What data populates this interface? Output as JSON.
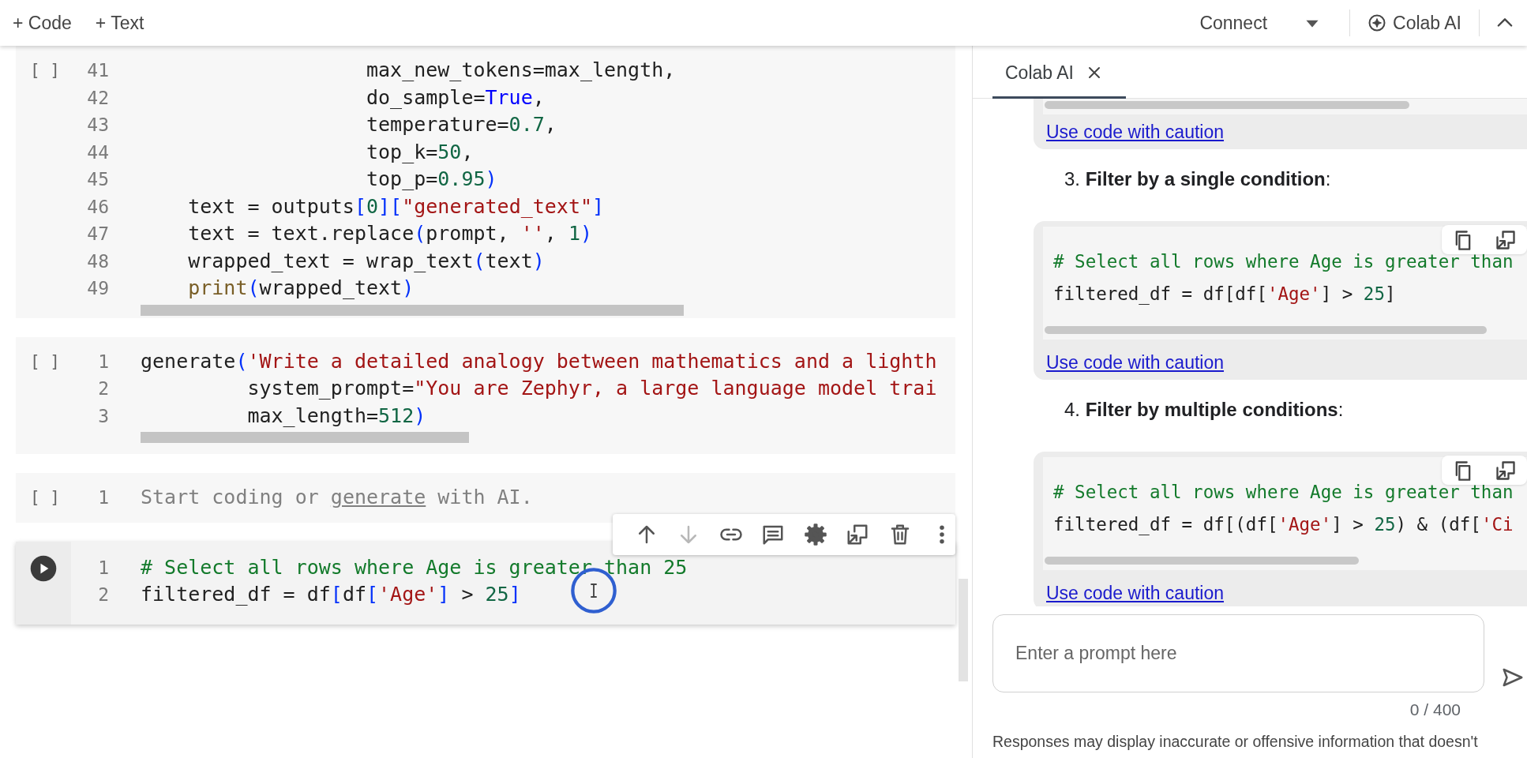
{
  "top_bar": {
    "insert_buttons": [
      "+ Code",
      "+ Text"
    ],
    "connect_button": "Connect",
    "ai_button": "Colab AI"
  },
  "cells": [
    {
      "focused": false,
      "exec_label": "[ ]",
      "scrollable": true,
      "lines": [
        {
          "number": "41",
          "tokens": [
            {
              "text": "                   max_new_tokens=max_length,",
              "kind": "plain"
            }
          ]
        },
        {
          "number": "42",
          "tokens": [
            {
              "text": "                   do_sample=",
              "kind": "plain"
            },
            {
              "text": "True",
              "kind": "keyword"
            },
            {
              "text": ",",
              "kind": "plain"
            }
          ]
        },
        {
          "number": "43",
          "tokens": [
            {
              "text": "                   temperature=",
              "kind": "plain"
            },
            {
              "text": "0.7",
              "kind": "number"
            },
            {
              "text": ",",
              "kind": "plain"
            }
          ]
        },
        {
          "number": "44",
          "tokens": [
            {
              "text": "                   top_k=",
              "kind": "plain"
            },
            {
              "text": "50",
              "kind": "number"
            },
            {
              "text": ",",
              "kind": "plain"
            }
          ]
        },
        {
          "number": "45",
          "tokens": [
            {
              "text": "                   top_p=",
              "kind": "plain"
            },
            {
              "text": "0.95",
              "kind": "number"
            },
            {
              "text": ")",
              "kind": "bracket"
            }
          ]
        },
        {
          "number": "46",
          "tokens": [
            {
              "text": "    text = outputs",
              "kind": "plain"
            },
            {
              "text": "[",
              "kind": "bracket"
            },
            {
              "text": "0",
              "kind": "number"
            },
            {
              "text": "][",
              "kind": "bracket"
            },
            {
              "text": "\"generated_text\"",
              "kind": "string"
            },
            {
              "text": "]",
              "kind": "bracket"
            }
          ]
        },
        {
          "number": "47",
          "tokens": [
            {
              "text": "    text = text.replace",
              "kind": "plain"
            },
            {
              "text": "(",
              "kind": "bracket"
            },
            {
              "text": "prompt, ",
              "kind": "plain"
            },
            {
              "text": "''",
              "kind": "string"
            },
            {
              "text": ", ",
              "kind": "plain"
            },
            {
              "text": "1",
              "kind": "number"
            },
            {
              "text": ")",
              "kind": "bracket"
            }
          ]
        },
        {
          "number": "48",
          "tokens": [
            {
              "text": "    wrapped_text = wrap_text",
              "kind": "plain"
            },
            {
              "text": "(",
              "kind": "bracket"
            },
            {
              "text": "text",
              "kind": "plain"
            },
            {
              "text": ")",
              "kind": "bracket"
            }
          ]
        },
        {
          "number": "49",
          "tokens": [
            {
              "text": "    print",
              "kind": "function"
            },
            {
              "text": "(",
              "kind": "bracket"
            },
            {
              "text": "wrapped_text",
              "kind": "plain"
            },
            {
              "text": ")",
              "kind": "bracket"
            }
          ]
        }
      ]
    },
    {
      "focused": false,
      "exec_label": "[ ]",
      "scrollable": true,
      "lines": [
        {
          "number": "1",
          "tokens": [
            {
              "text": "generate",
              "kind": "plain"
            },
            {
              "text": "(",
              "kind": "bracket"
            },
            {
              "text": "'Write a detailed analogy between mathematics and a lighth",
              "kind": "string"
            }
          ]
        },
        {
          "number": "2",
          "tokens": [
            {
              "text": "         system_prompt=",
              "kind": "plain"
            },
            {
              "text": "\"You are Zephyr, a large language model trai",
              "kind": "string"
            }
          ]
        },
        {
          "number": "3",
          "tokens": [
            {
              "text": "         max_length=",
              "kind": "plain"
            },
            {
              "text": "512",
              "kind": "number"
            },
            {
              "text": ")",
              "kind": "bracket"
            }
          ]
        }
      ]
    },
    {
      "focused": false,
      "exec_label": "[ ]",
      "scrollable": false,
      "lines": [
        {
          "number": "1",
          "tokens": [
            {
              "text": "Start coding or ",
              "kind": "hint"
            },
            {
              "text": "generate",
              "kind": "hint-link"
            },
            {
              "text": " with AI.",
              "kind": "hint"
            }
          ]
        }
      ]
    },
    {
      "focused": true,
      "scrollable": false,
      "lines": [
        {
          "number": "1",
          "tokens": [
            {
              "text": "# Select all rows where Age is greater than 25",
              "kind": "comment"
            }
          ]
        },
        {
          "number": "2",
          "tokens": [
            {
              "text": "filtered_df = df",
              "kind": "plain"
            },
            {
              "text": "[",
              "kind": "bracket"
            },
            {
              "text": "df",
              "kind": "plain"
            },
            {
              "text": "[",
              "kind": "bracket"
            },
            {
              "text": "'Age'",
              "kind": "string"
            },
            {
              "text": "]",
              "kind": "bracket"
            },
            {
              "text": " > ",
              "kind": "plain"
            },
            {
              "text": "25",
              "kind": "number"
            },
            {
              "text": "]",
              "kind": "bracket"
            }
          ]
        }
      ]
    }
  ],
  "cell_toolbar": [
    {
      "disabled": false
    },
    {
      "disabled": true
    },
    {
      "disabled": false
    },
    {
      "disabled": false
    },
    {
      "disabled": false
    },
    {
      "disabled": false
    },
    {
      "disabled": false
    },
    {
      "disabled": false
    }
  ],
  "ai_panel": {
    "tab": {
      "label": "Colab AI",
      "selected": true
    },
    "messages": [
      {
        "kind": "code",
        "link": "Use code with caution"
      },
      {
        "kind": "heading",
        "text": "3. **Filter by a single condition**:"
      },
      {
        "kind": "code",
        "lines": [
          {
            "tokens": [
              {
                "text": "# Select all rows where Age is greater than",
                "kind": "comment"
              }
            ]
          },
          {
            "tokens": [
              {
                "text": "filtered_df = df[df[",
                "kind": "plain"
              },
              {
                "text": "'Age'",
                "kind": "string"
              },
              {
                "text": "] > ",
                "kind": "plain"
              },
              {
                "text": "25",
                "kind": "number"
              },
              {
                "text": "]",
                "kind": "plain"
              }
            ]
          }
        ],
        "link": "Use code with caution"
      },
      {
        "kind": "heading",
        "text": "4. **Filter by multiple conditions**:"
      },
      {
        "kind": "code",
        "lines": [
          {
            "tokens": [
              {
                "text": "# Select all rows where Age is greater than",
                "kind": "comment"
              }
            ]
          },
          {
            "tokens": [
              {
                "text": "filtered_df = df[(df[",
                "kind": "plain"
              },
              {
                "text": "'Age'",
                "kind": "string"
              },
              {
                "text": "] > ",
                "kind": "plain"
              },
              {
                "text": "25",
                "kind": "number"
              },
              {
                "text": ") & (df[",
                "kind": "plain"
              },
              {
                "text": "'Ci",
                "kind": "string"
              }
            ]
          }
        ],
        "link": "Use code with caution"
      }
    ],
    "prompt": {
      "placeholder": "Enter a prompt here"
    },
    "counter": "0 / 400",
    "disclaimer": "Responses may display inaccurate or offensive information that doesn't"
  }
}
